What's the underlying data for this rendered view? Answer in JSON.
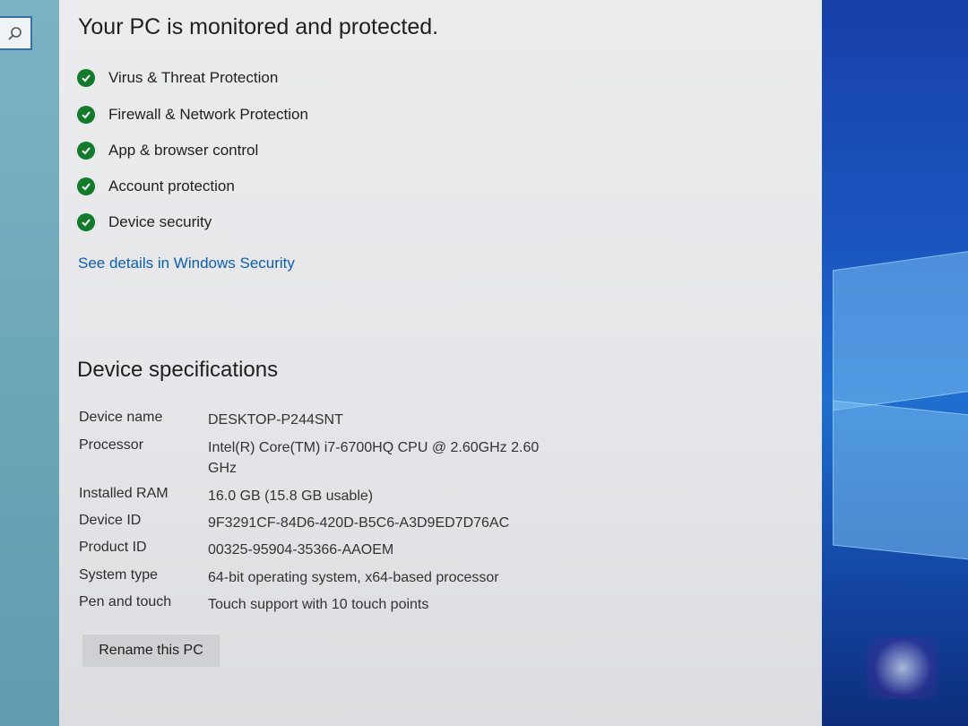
{
  "search": {
    "icon": "search-icon"
  },
  "protection": {
    "title": "Your PC is monitored and protected.",
    "check_icon": "check-circle-icon",
    "check_color": "#137a2c",
    "items": [
      {
        "label": "Virus & Threat Protection"
      },
      {
        "label": "Firewall & Network Protection"
      },
      {
        "label": "App & browser control"
      },
      {
        "label": "Account protection"
      },
      {
        "label": "Device security"
      }
    ],
    "details_link": "See details in Windows Security"
  },
  "specs": {
    "title": "Device specifications",
    "rows": [
      {
        "label": "Device name",
        "value": "DESKTOP-P244SNT"
      },
      {
        "label": "Processor",
        "value": "Intel(R) Core(TM) i7-6700HQ CPU @ 2.60GHz   2.60 GHz"
      },
      {
        "label": "Installed RAM",
        "value": "16.0 GB (15.8 GB usable)"
      },
      {
        "label": "Device ID",
        "value": "9F3291CF-84D6-420D-B5C6-A3D9ED7D76AC"
      },
      {
        "label": "Product ID",
        "value": "00325-95904-35366-AAOEM"
      },
      {
        "label": "System type",
        "value": "64-bit operating system, x64-based processor"
      },
      {
        "label": "Pen and touch",
        "value": "Touch support with 10 touch points"
      }
    ],
    "rename_button": "Rename this PC"
  },
  "colors": {
    "accent_link": "#0b5fb0",
    "desktop_blue": "#1b57c0"
  }
}
